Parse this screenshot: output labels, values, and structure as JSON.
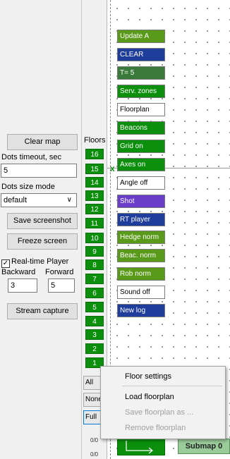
{
  "left_panel": {
    "clear_map": "Clear map",
    "dots_timeout_label": "Dots timeout, sec",
    "dots_timeout_value": "5",
    "dots_size_label": "Dots size mode",
    "dots_size_value": "default",
    "save_screenshot": "Save screenshot",
    "freeze_screen": "Freeze screen",
    "realtime_player": "Real-time Player",
    "realtime_checked": "✓",
    "backward_label": "Backward",
    "forward_label": "Forward",
    "backward_value": "3",
    "forward_value": "5",
    "stream_capture": "Stream capture"
  },
  "floors": {
    "title": "Floors",
    "items": [
      "16",
      "15",
      "14",
      "13",
      "12",
      "11",
      "10",
      "9",
      "8",
      "7",
      "6",
      "5",
      "4",
      "3",
      "2",
      "1"
    ],
    "btn_all": "All",
    "btn_none": "None",
    "btn_full": "Full",
    "count1": "0/0",
    "count2": "0/0"
  },
  "map_buttons": [
    {
      "label": "Update A",
      "bg": "#5a9a1a",
      "fg": "#ffffff"
    },
    {
      "label": "CLEAR",
      "bg": "#1f3d9a",
      "fg": "#ffffff"
    },
    {
      "label": "T= 5",
      "bg": "#3a7a3a",
      "fg": "#ffffff"
    },
    {
      "label": "Serv. zones",
      "bg": "#0c8f0c",
      "fg": "#ffffff"
    },
    {
      "label": "Floorplan",
      "bg": "#ffffff",
      "fg": "#000000"
    },
    {
      "label": "Beacons",
      "bg": "#0c8f0c",
      "fg": "#ffffff"
    },
    {
      "label": "Grid on",
      "bg": "#0c8f0c",
      "fg": "#ffffff"
    },
    {
      "label": "Axes on",
      "bg": "#0c8f0c",
      "fg": "#ffffff"
    },
    {
      "label": "Angle off",
      "bg": "#ffffff",
      "fg": "#000000"
    },
    {
      "label": "Shot",
      "bg": "#6a3ec9",
      "fg": "#ffffff"
    },
    {
      "label": "RT player",
      "bg": "#1f3d9a",
      "fg": "#ffffff"
    },
    {
      "label": "Hedge norm",
      "bg": "#5a9a1a",
      "fg": "#ffffff"
    },
    {
      "label": "Beac. norm",
      "bg": "#5a9a1a",
      "fg": "#ffffff"
    },
    {
      "label": "Rob norm",
      "bg": "#5a9a1a",
      "fg": "#ffffff"
    },
    {
      "label": "Sound off",
      "bg": "#ffffff",
      "fg": "#000000"
    },
    {
      "label": "New log",
      "bg": "#1f3d9a",
      "fg": "#ffffff"
    }
  ],
  "context_menu": {
    "floor_settings": "Floor settings",
    "load_floorplan": "Load floorplan",
    "save_floorplan": "Save floorplan as ...",
    "remove_floorplan": "Remove floorplan"
  },
  "bottom": {
    "submap": "Submap 0",
    "xmark": "x"
  }
}
